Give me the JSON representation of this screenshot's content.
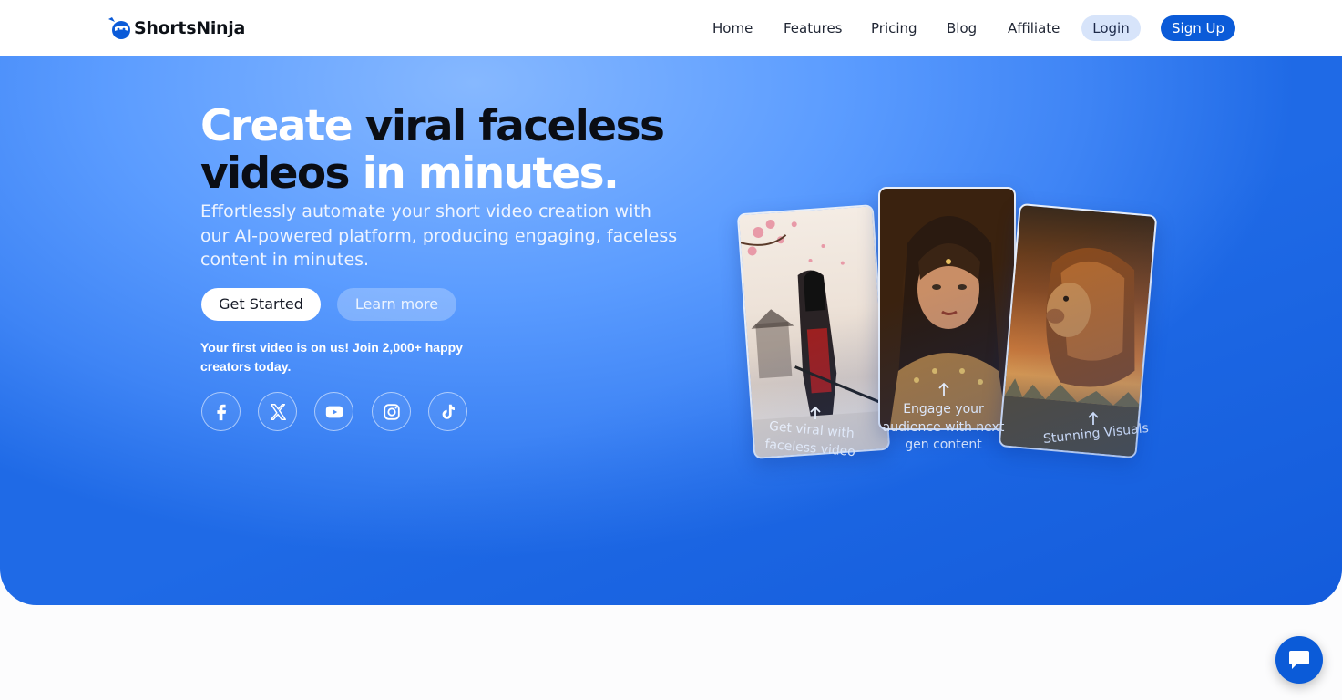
{
  "nav": {
    "logo_text": "ShortsNinja",
    "links": [
      "Home",
      "Features",
      "Pricing",
      "Blog",
      "Affiliate"
    ],
    "login_label": "Login",
    "signup_label": "Sign Up"
  },
  "hero": {
    "headline": {
      "part1": "Create ",
      "part2": "viral faceless",
      "part3": "videos",
      "part4": " in minutes."
    },
    "subtext": "Effortlessly automate your short video creation with our AI-powered platform, producing engaging, faceless content in minutes.",
    "get_started_label": "Get Started",
    "learn_more_label": "Learn more",
    "promo_text": "Your first video is on us! Join 2,000+ happy creators today.",
    "socials": [
      "facebook-icon",
      "x-icon",
      "youtube-icon",
      "instagram-icon",
      "tiktok-icon"
    ]
  },
  "showcase": {
    "captions": [
      "Get viral with faceless video",
      "Engage your audience with next gen content",
      "Stunning Visuals"
    ]
  },
  "colors": {
    "accent": "#0b5bd8",
    "login_bg": "#d7e4fa",
    "hero_light": "#86b8ff",
    "hero_dark": "#1f6ae6"
  }
}
